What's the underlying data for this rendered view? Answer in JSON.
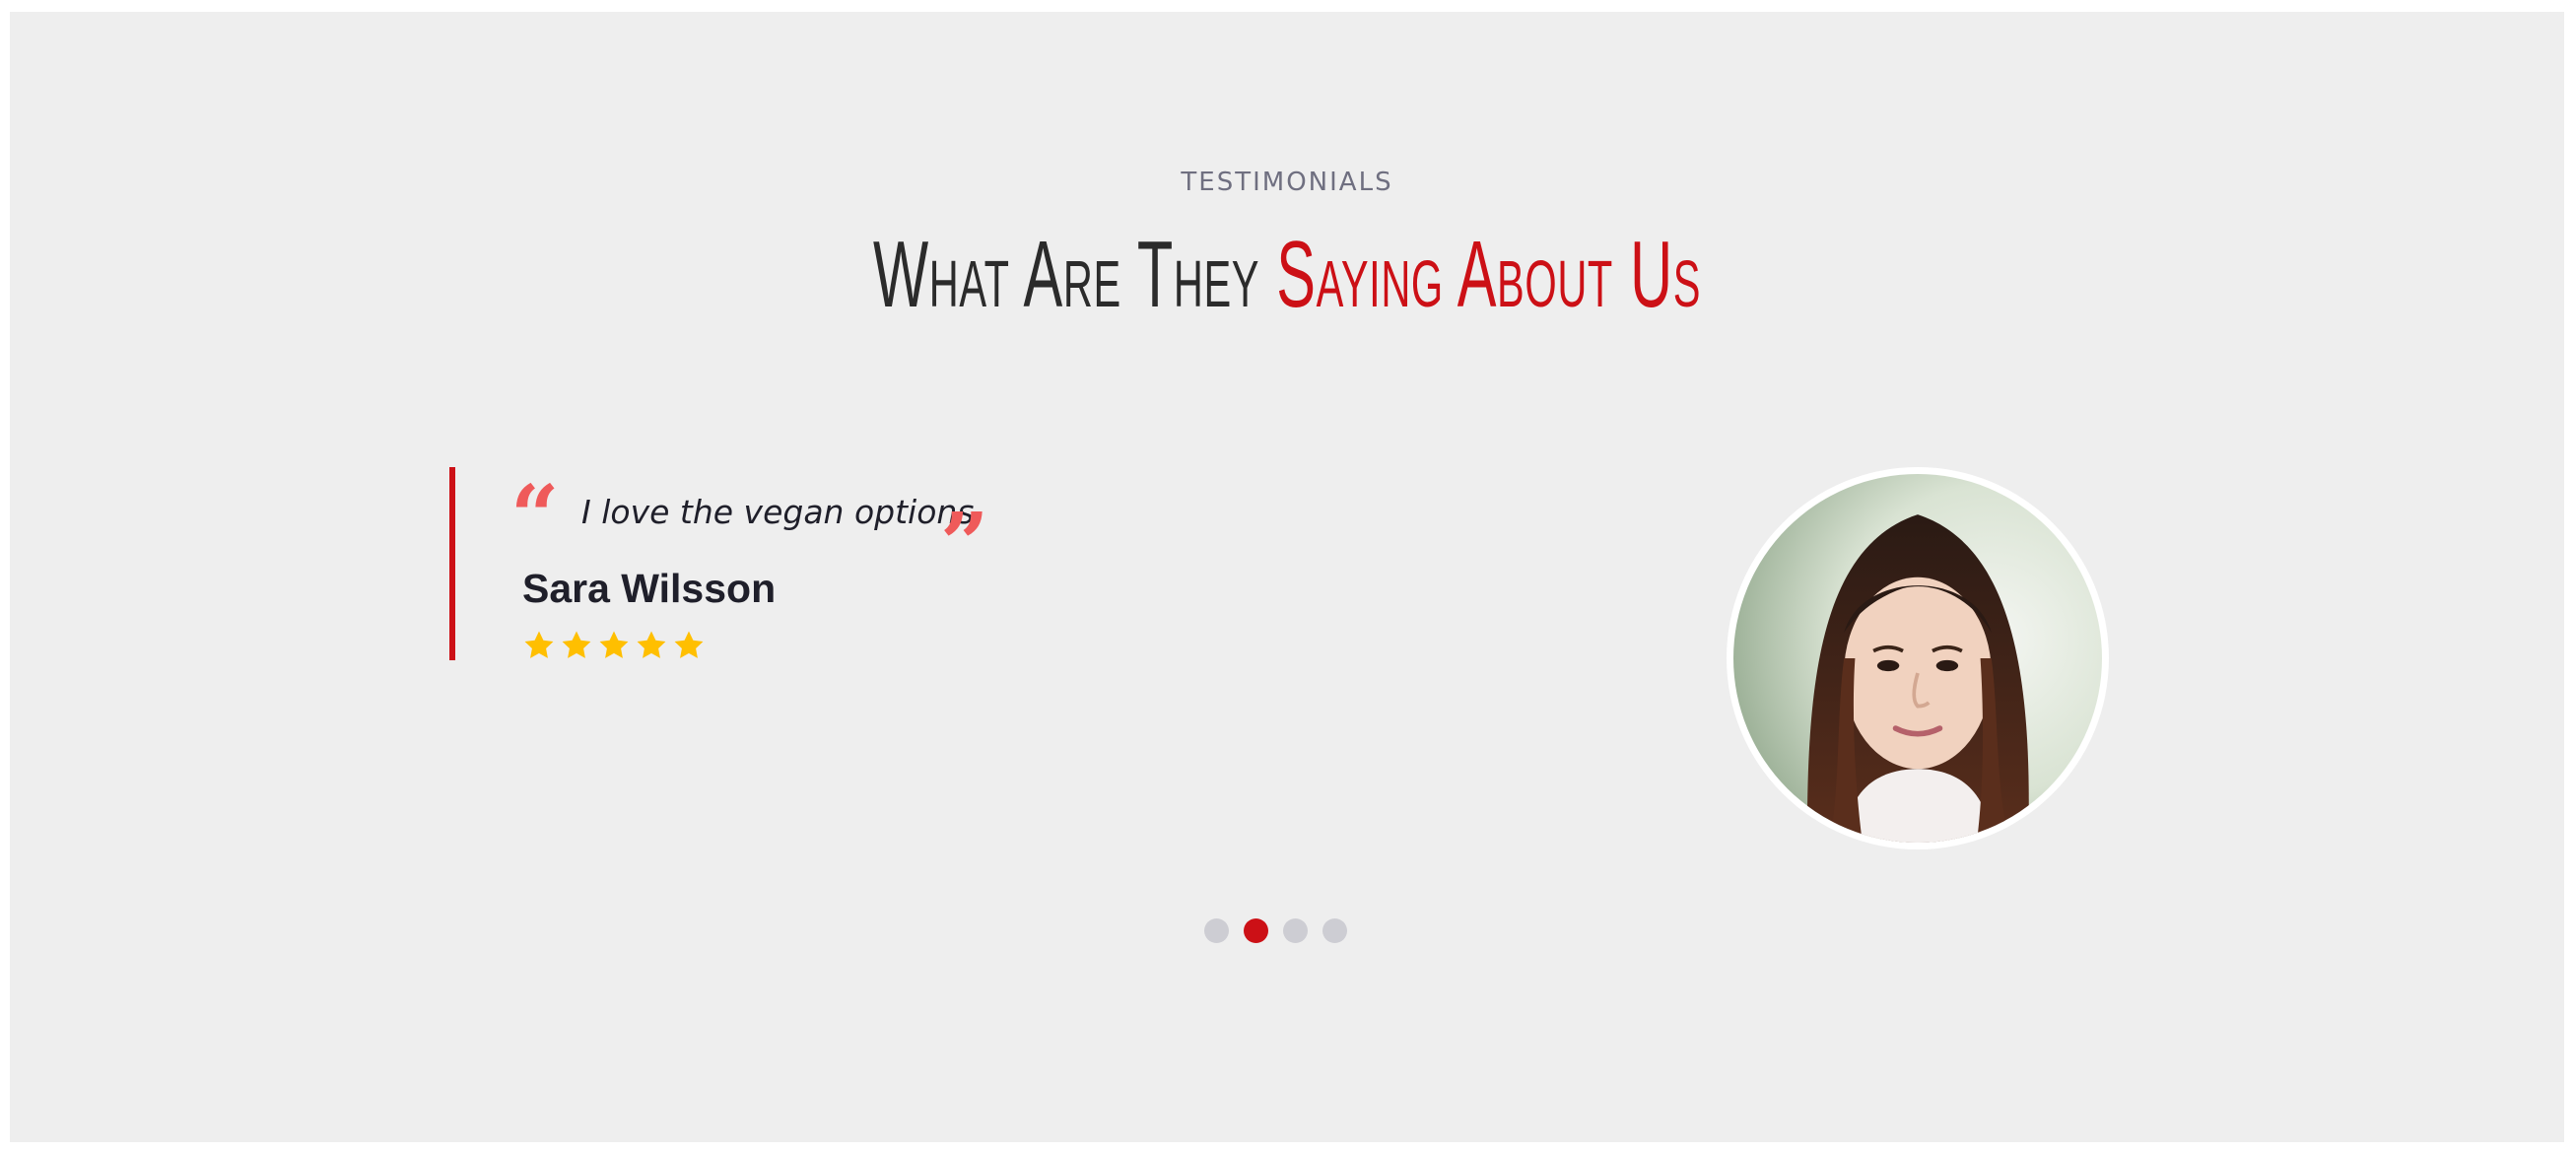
{
  "section": {
    "eyebrow": "TESTIMONIALS",
    "title_part1": "What Are They ",
    "title_part2": "Saying About Us"
  },
  "testimonial": {
    "quote": "I love the vegan options.",
    "author": "Sara Wilsson",
    "rating": 5,
    "rating_max": 5,
    "avatar_icon": "person-portrait"
  },
  "carousel": {
    "total": 4,
    "active_index": 1
  },
  "colors": {
    "accent": "#cc1016",
    "quote_mark": "#ef5a5a",
    "star": "#ffbf00",
    "dot_inactive": "#cdcdd3",
    "background": "#eeeeee"
  }
}
